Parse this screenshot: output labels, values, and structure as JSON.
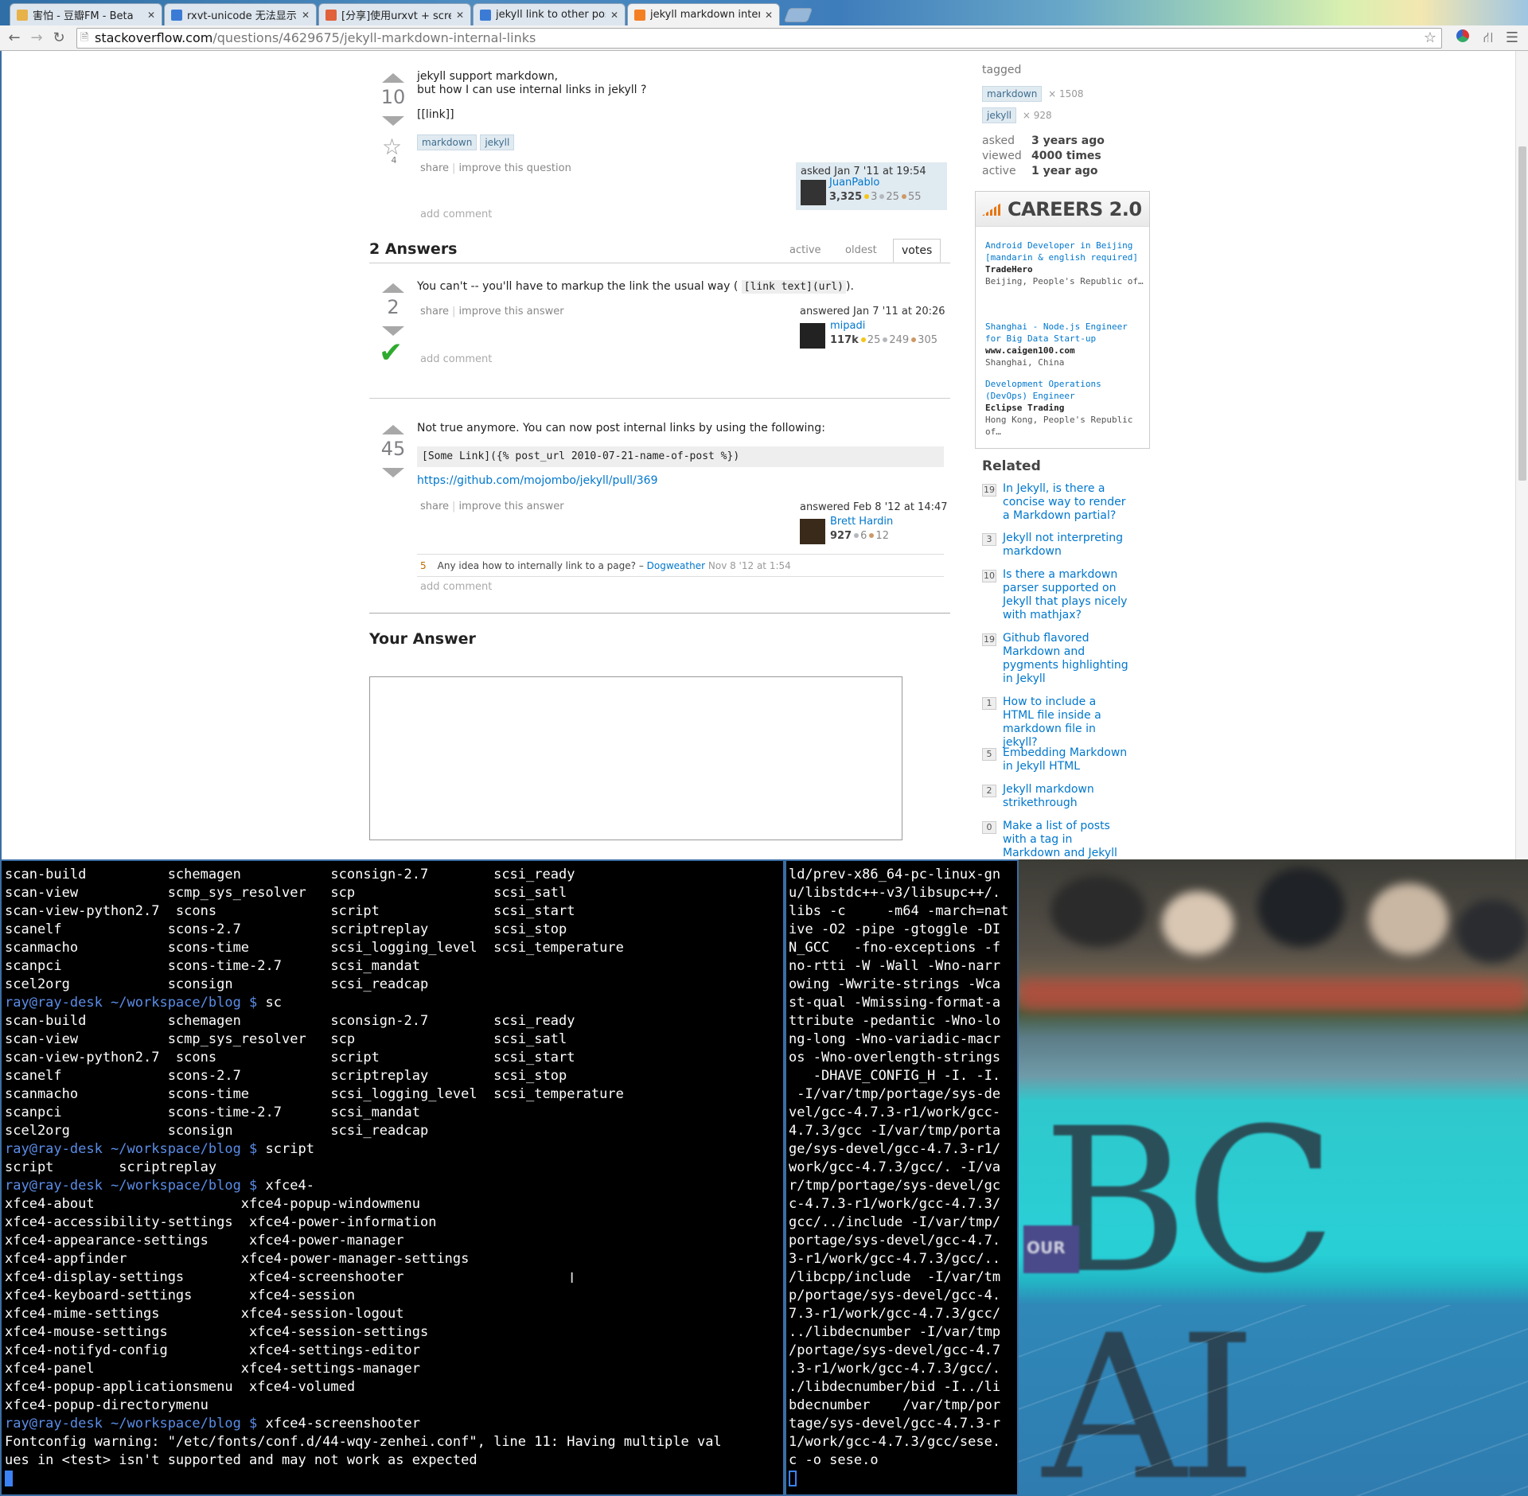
{
  "browser": {
    "tabs": [
      {
        "title": "害怕 - 豆瓣FM - Beta",
        "fav_color": "#e8b24a",
        "active": false
      },
      {
        "title": "rxvt-unicode 无法显示简",
        "fav_color": "#3b7bd6",
        "active": false
      },
      {
        "title": "[分享]使用urxvt + scree",
        "fav_color": "#e0613a",
        "active": false
      },
      {
        "title": "jekyll link to other posts",
        "fav_color": "#3b7bd6",
        "active": false
      },
      {
        "title": "jekyll markdown interna",
        "fav_color": "#f48024",
        "active": true
      }
    ],
    "url_host": "stackoverflow.com",
    "url_path": "/questions/4629675/jekyll-markdown-internal-links",
    "icons": {
      "back": "back-arrow-icon",
      "forward": "forward-arrow-icon",
      "reload": "reload-icon",
      "bookmark": "star-icon",
      "menu": "menu-icon"
    }
  },
  "question": {
    "votes": "10",
    "favorites": "4",
    "body_line1": "jekyll support markdown,",
    "body_line2": "but how I can use internal links in jekyll ?",
    "body_line3": "[[link]]",
    "tags": [
      "markdown",
      "jekyll"
    ],
    "menu": {
      "share": "share",
      "improve": "improve this question"
    },
    "asked_label": "asked Jan 7 '11 at 19:54",
    "user": "JuanPablo",
    "rep": "3,325",
    "badges": {
      "gold": "3",
      "silver": "25",
      "bronze": "55"
    },
    "add_comment": "add comment"
  },
  "answers_header": {
    "title": "2 Answers",
    "tabs": [
      "active",
      "oldest",
      "votes"
    ]
  },
  "answers": [
    {
      "votes": "2",
      "accepted": true,
      "text_before": "You can't -- you'll have to markup the link the usual way (",
      "code": "[link text](url)",
      "text_after": ").",
      "share": "share",
      "improve": "improve this answer",
      "answered": "answered Jan 7 '11 at 20:26",
      "user": "mipadi",
      "rep": "117k",
      "badges": {
        "gold": "25",
        "silver": "249",
        "bronze": "305"
      },
      "add_comment": "add comment"
    },
    {
      "votes": "45",
      "text": "Not true anymore. You can now post internal links by using the following:",
      "code_block": "[Some Link]({% post_url 2010-07-21-name-of-post %})",
      "link": "https://github.com/mojombo/jekyll/pull/369",
      "share": "share",
      "improve": "improve this answer",
      "answered": "answered Feb 8 '12 at 14:47",
      "user": "Brett Hardin",
      "rep": "927",
      "badges": {
        "silver": "6",
        "bronze": "12"
      },
      "comment": {
        "score": "5",
        "text": "Any idea how to internally link to a page? –",
        "user": "Dogweather",
        "date": "Nov 8 '12 at 1:54"
      },
      "add_comment": "add comment"
    }
  ],
  "your_answer": {
    "title": "Your Answer"
  },
  "sidebar": {
    "tagged_label": "tagged",
    "tags": [
      {
        "name": "markdown",
        "count": "× 1508"
      },
      {
        "name": "jekyll",
        "count": "× 928"
      }
    ],
    "stats": [
      {
        "label": "asked",
        "value": "3 years ago"
      },
      {
        "label": "viewed",
        "value": "4000 times"
      },
      {
        "label": "active",
        "value": "1 year ago"
      }
    ],
    "careers_title": "CAREERS 2.0",
    "jobs": [
      {
        "title": "Android Developer in Beijing [mandarin & english required]",
        "company": "TradeHero",
        "location": "Beijing, People's Republic of…"
      },
      {
        "title": "Shanghai - Node.js Engineer for Big Data Start-up",
        "company": "www.caigen100.com",
        "location": "Shanghai, China"
      },
      {
        "title": "Development Operations (DevOps) Engineer",
        "company": "Eclipse Trading",
        "location": "Hong Kong, People's Republic of…"
      }
    ],
    "related_title": "Related",
    "related": [
      {
        "count": "19",
        "title": "In Jekyll, is there a concise way to render a Markdown partial?"
      },
      {
        "count": "3",
        "title": "Jekyll not interpreting markdown"
      },
      {
        "count": "10",
        "title": "Is there a markdown parser supported on Jekyll that plays nicely with mathjax?"
      },
      {
        "count": "19",
        "title": "Github flavored Markdown and pygments highlighting in Jekyll"
      },
      {
        "count": "1",
        "title": "How to include a HTML file inside a markdown file in jekyll?"
      },
      {
        "count": "5",
        "title": "Embedding Markdown in Jekyll HTML"
      },
      {
        "count": "2",
        "title": "Jekyll markdown strikethrough"
      },
      {
        "count": "0",
        "title": "Make a list of posts with a tag in Markdown and Jekyll"
      }
    ]
  },
  "terminal_left": {
    "prompt": "ray@ray-desk ~/workspace/blog $",
    "lines": [
      {
        "t": "scan-build          schemagen           sconsign-2.7        scsi_ready"
      },
      {
        "t": "scan-view           scmp_sys_resolver   scp                 scsi_satl"
      },
      {
        "t": "scan-view-python2.7  scons              script              scsi_start"
      },
      {
        "t": "scanelf             scons-2.7           scriptreplay        scsi_stop"
      },
      {
        "t": "scanmacho           scons-time          scsi_logging_level  scsi_temperature"
      },
      {
        "t": "scanpci             scons-time-2.7      scsi_mandat"
      },
      {
        "t": "scel2org            sconsign            scsi_readcap"
      },
      {
        "p": true,
        "cmd": " sc"
      },
      {
        "t": "scan-build          schemagen           sconsign-2.7        scsi_ready"
      },
      {
        "t": "scan-view           scmp_sys_resolver   scp                 scsi_satl"
      },
      {
        "t": "scan-view-python2.7  scons              script              scsi_start"
      },
      {
        "t": "scanelf             scons-2.7           scriptreplay        scsi_stop"
      },
      {
        "t": "scanmacho           scons-time          scsi_logging_level  scsi_temperature"
      },
      {
        "t": "scanpci             scons-time-2.7      scsi_mandat"
      },
      {
        "t": "scel2org            sconsign            scsi_readcap"
      },
      {
        "p": true,
        "cmd": " script"
      },
      {
        "t": "script        scriptreplay"
      },
      {
        "p": true,
        "cmd": " xfce4-"
      },
      {
        "t": "xfce4-about                  xfce4-popup-windowmenu"
      },
      {
        "t": "xfce4-accessibility-settings  xfce4-power-information"
      },
      {
        "t": "xfce4-appearance-settings     xfce4-power-manager"
      },
      {
        "t": "xfce4-appfinder              xfce4-power-manager-settings"
      },
      {
        "t": "xfce4-display-settings        xfce4-screenshooter"
      },
      {
        "t": "xfce4-keyboard-settings       xfce4-session"
      },
      {
        "t": "xfce4-mime-settings          xfce4-session-logout"
      },
      {
        "t": "xfce4-mouse-settings          xfce4-session-settings"
      },
      {
        "t": "xfce4-notifyd-config          xfce4-settings-editor"
      },
      {
        "t": "xfce4-panel                  xfce4-settings-manager"
      },
      {
        "t": "xfce4-popup-applicationsmenu  xfce4-volumed"
      },
      {
        "t": "xfce4-popup-directorymenu"
      },
      {
        "p": true,
        "cmd": " xfce4-screenshooter"
      },
      {
        "t": "Fontconfig warning: \"/etc/fonts/conf.d/44-wqy-zenhei.conf\", line 11: Having multiple val"
      },
      {
        "t": "ues in <test> isn't supported and may not work as expected"
      }
    ]
  },
  "terminal_mid": {
    "lines": [
      "ld/prev-x86_64-pc-linux-gn",
      "u/libstdc++-v3/libsupc++/.",
      "libs -c     -m64 -march=nat",
      "ive -O2 -pipe -gtoggle -DI",
      "N_GCC   -fno-exceptions -f",
      "no-rtti -W -Wall -Wno-narr",
      "owing -Wwrite-strings -Wca",
      "st-qual -Wmissing-format-a",
      "ttribute -pedantic -Wno-lo",
      "ng-long -Wno-variadic-macr",
      "os -Wno-overlength-strings",
      "   -DHAVE_CONFIG_H -I. -I.",
      " -I/var/tmp/portage/sys-de",
      "vel/gcc-4.7.3-r1/work/gcc-",
      "4.7.3/gcc -I/var/tmp/porta",
      "ge/sys-devel/gcc-4.7.3-r1/",
      "work/gcc-4.7.3/gcc/. -I/va",
      "r/tmp/portage/sys-devel/gc",
      "c-4.7.3-r1/work/gcc-4.7.3/",
      "gcc/../include -I/var/tmp/",
      "portage/sys-devel/gcc-4.7.",
      "3-r1/work/gcc-4.7.3/gcc/..",
      "/libcpp/include  -I/var/tm",
      "p/portage/sys-devel/gcc-4.",
      "7.3-r1/work/gcc-4.7.3/gcc/",
      "../libdecnumber -I/var/tmp",
      "/portage/sys-devel/gcc-4.7",
      ".3-r1/work/gcc-4.7.3/gcc/.",
      "./libdecnumber/bid -I../li",
      "bdecnumber    /var/tmp/por",
      "tage/sys-devel/gcc-4.7.3-r",
      "1/work/gcc-4.7.3/gcc/sese.",
      "c -o sese.o"
    ]
  },
  "photo": {
    "text": "BC AI",
    "badge": "OUR"
  }
}
